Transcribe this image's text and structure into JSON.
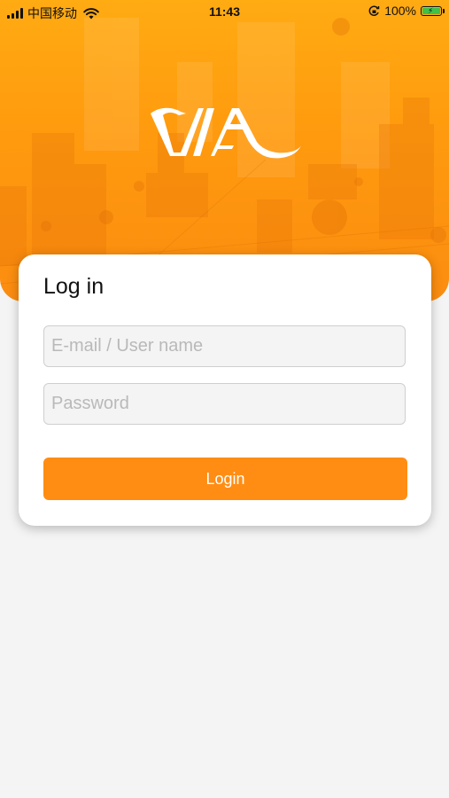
{
  "status_bar": {
    "carrier": "中国移动",
    "time": "11:43",
    "battery_percent": "100%",
    "battery_level": 1.0,
    "icons": [
      "signal-icon",
      "wifi-icon",
      "orientation-lock-icon",
      "battery-icon"
    ]
  },
  "brand": {
    "logo_text": "VIA"
  },
  "login_card": {
    "title": "Log in",
    "email_placeholder": "E-mail / User name",
    "email_value": "",
    "password_placeholder": "Password",
    "password_value": "",
    "login_label": "Login"
  },
  "colors": {
    "accent": "#ff8d14",
    "hero_top": "#ffab12",
    "hero_bottom": "#fb8c10",
    "page_background": "#f4f4f4"
  }
}
